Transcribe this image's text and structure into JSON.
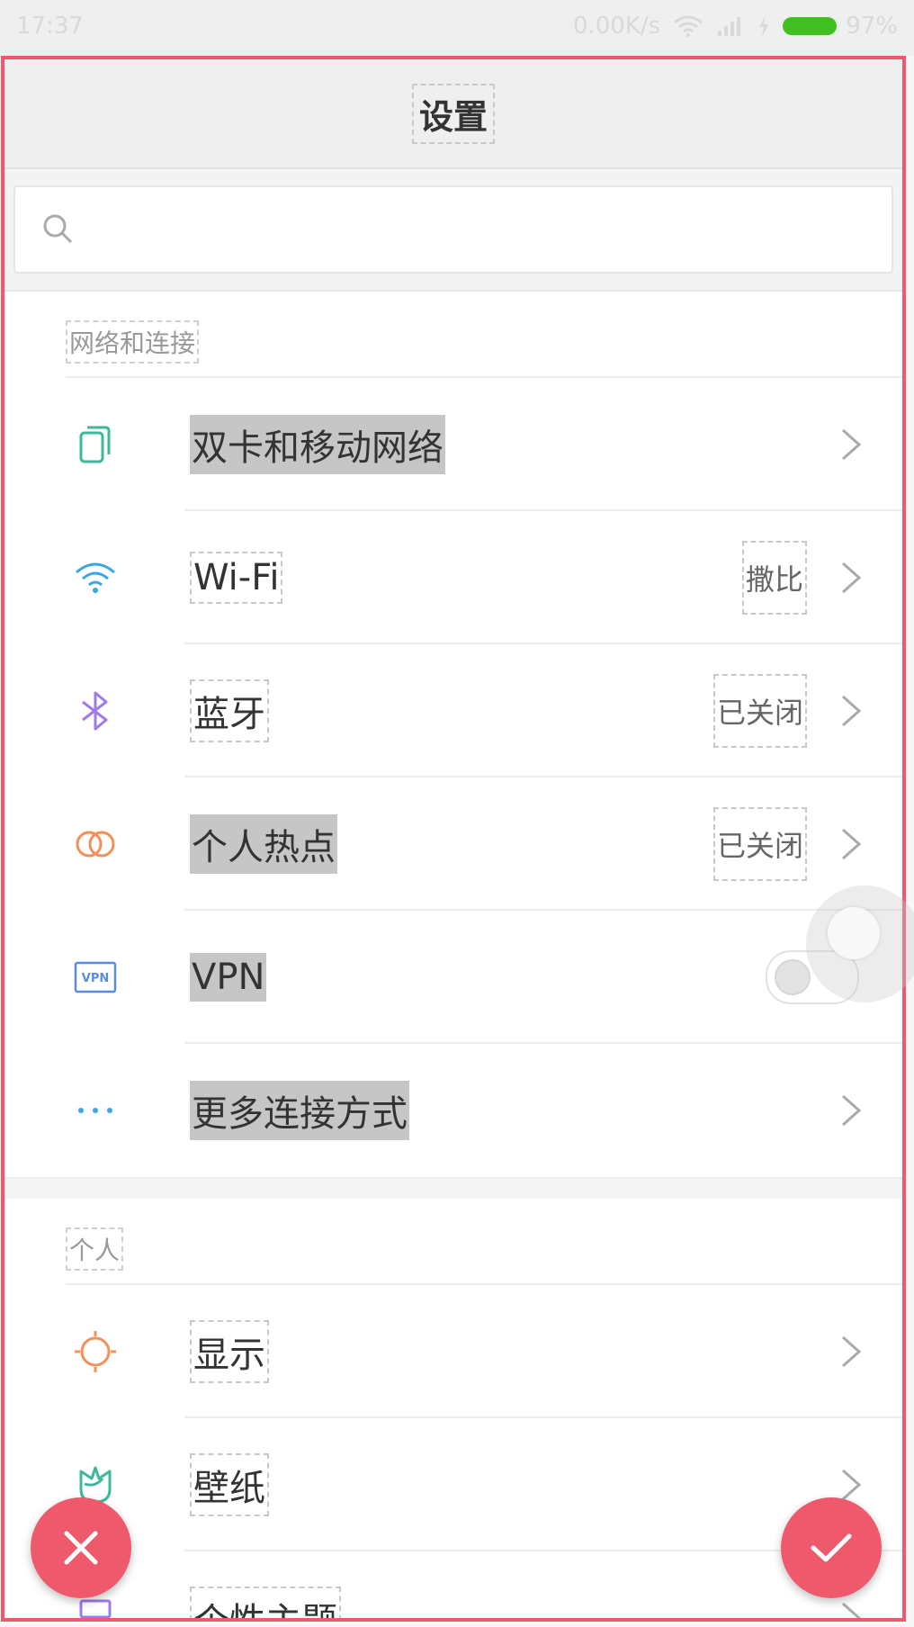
{
  "status_bar": {
    "time": "17:37",
    "speed": "0.00K/s",
    "battery": "97%",
    "battery_color": "#40c020"
  },
  "header": {
    "title": "设置"
  },
  "search": {
    "placeholder": ""
  },
  "sections": [
    {
      "label": "网络和连接",
      "items": [
        {
          "label": "双卡和移动网络",
          "icon": "sim-cards-icon",
          "icon_color": "#3cb89a"
        },
        {
          "label": "Wi-Fi",
          "status": "撒比",
          "icon": "wifi-icon",
          "icon_color": "#3aa8e0"
        },
        {
          "label": "蓝牙",
          "status": "已关闭",
          "icon": "bluetooth-icon",
          "icon_color": "#a07ae8"
        },
        {
          "label": "个人热点",
          "status": "已关闭",
          "icon": "hotspot-icon",
          "icon_color": "#f0915a"
        },
        {
          "label": "VPN",
          "icon": "vpn-icon",
          "icon_color": "#5b8be0",
          "icon_text": "VPN",
          "toggle": "off"
        },
        {
          "label": "更多连接方式",
          "icon": "more-dots-icon",
          "icon_color": "#3aa8e0"
        }
      ]
    },
    {
      "label": "个人",
      "items": [
        {
          "label": "显示",
          "icon": "sun-icon",
          "icon_color": "#f0915a"
        },
        {
          "label": "壁纸",
          "icon": "wallpaper-flower-icon",
          "icon_color": "#3cb89a"
        },
        {
          "label": "个性主题",
          "icon": "theme-brush-icon",
          "icon_color": "#a07ae8"
        }
      ]
    }
  ],
  "accent_color": "#ee5a6c"
}
